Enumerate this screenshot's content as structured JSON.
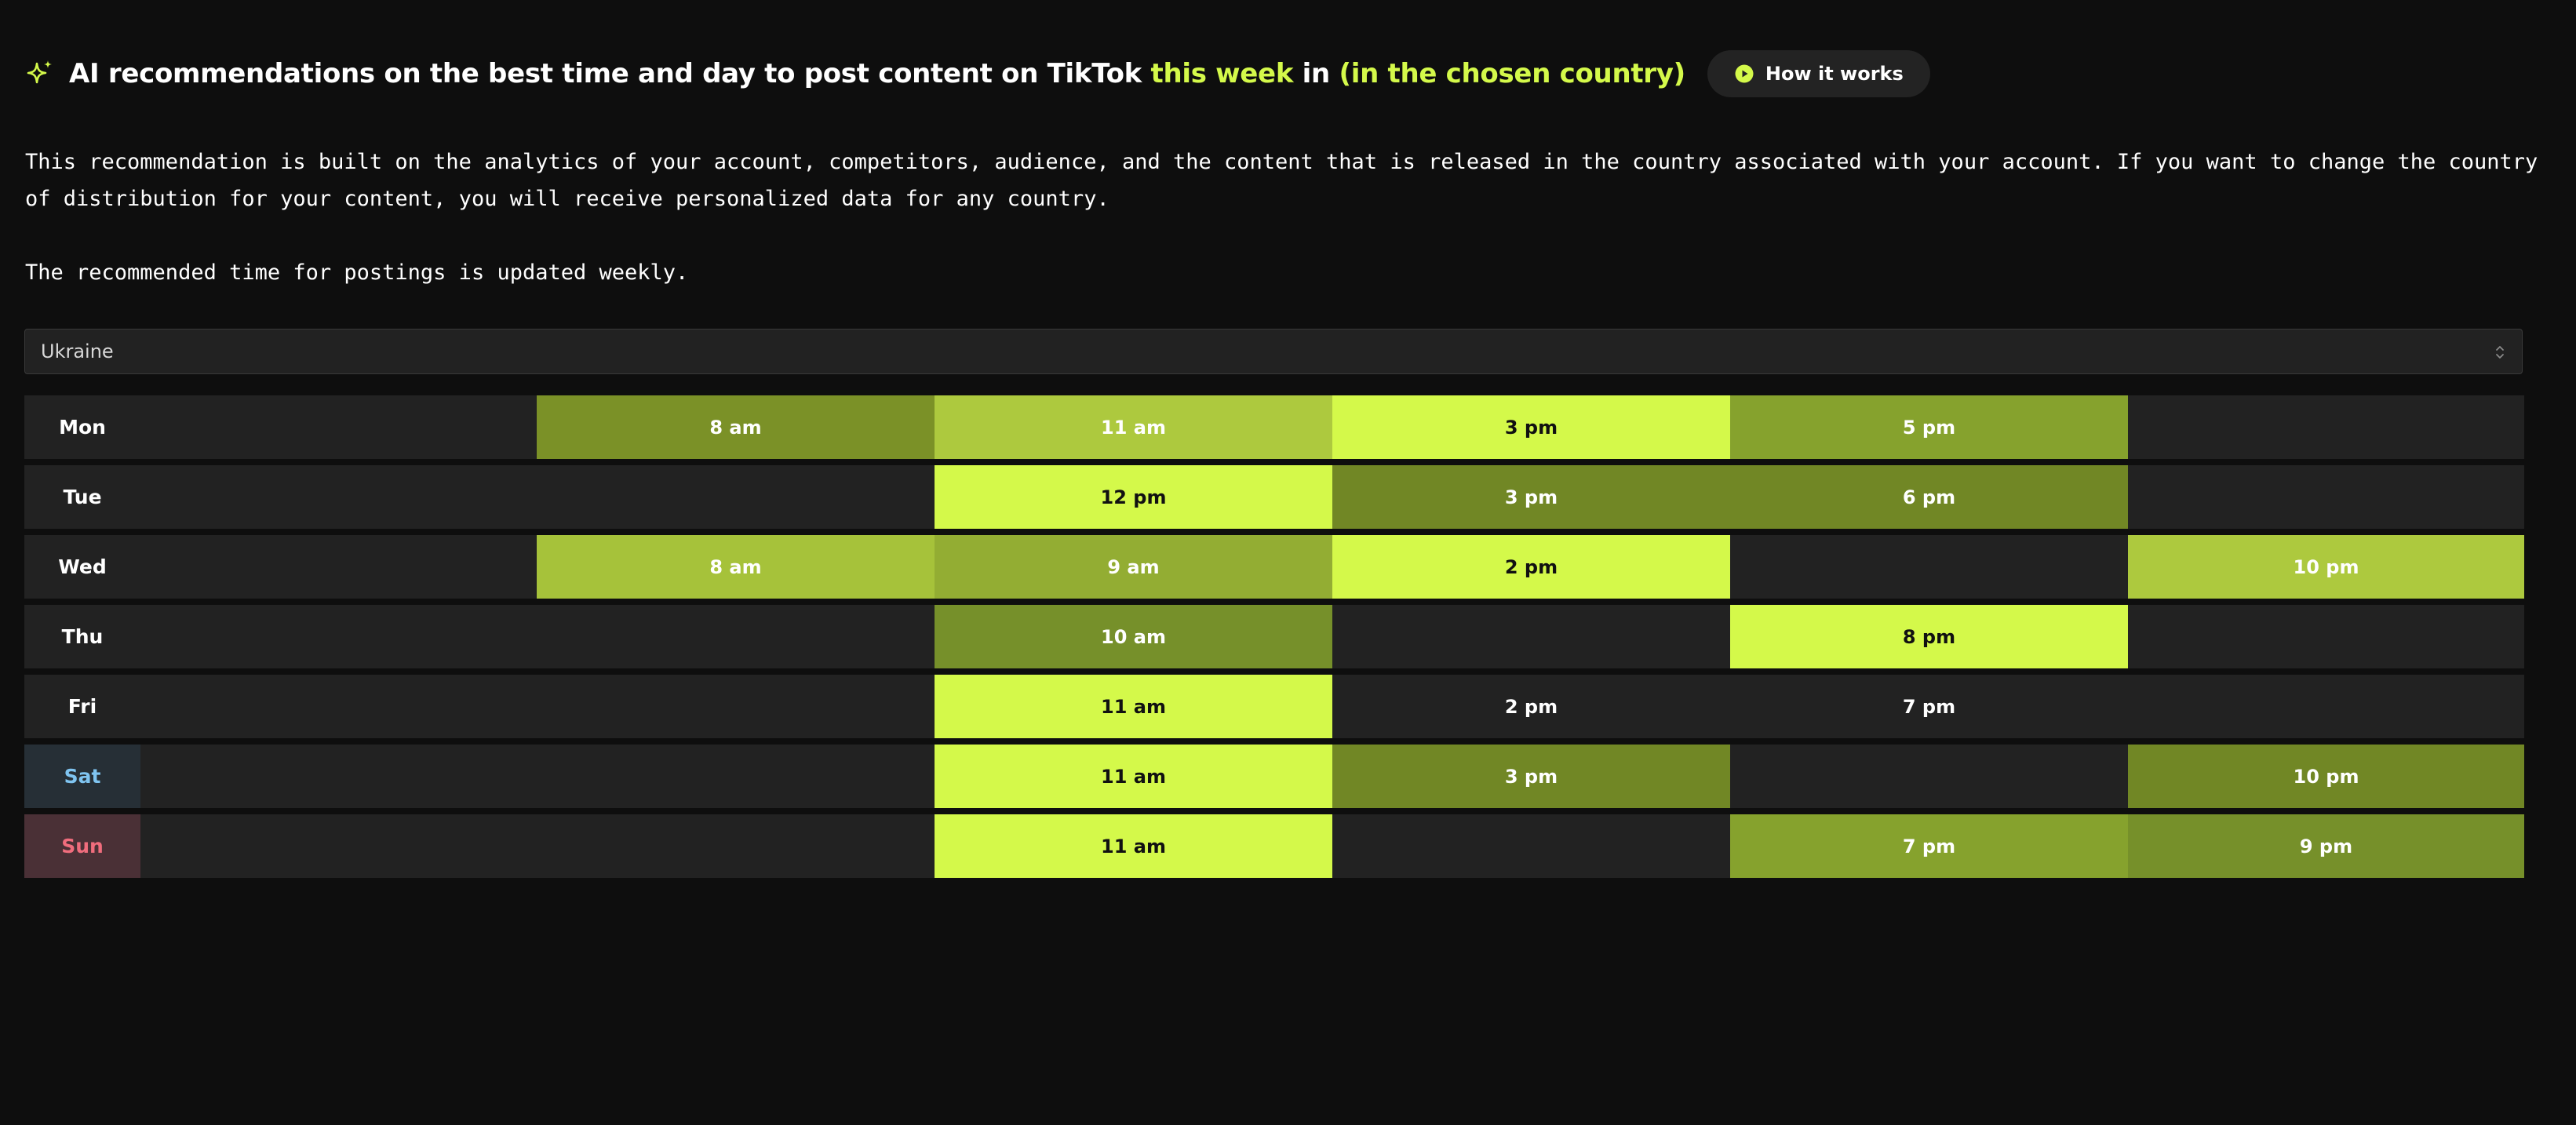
{
  "header": {
    "title_part1": "AI recommendations on the best time and day to post content on TikTok ",
    "title_highlight1": "this week",
    "title_part2": " in ",
    "title_highlight2": "(in the chosen country)",
    "how_it_works_label": "How it works",
    "icon": "sparkle-icon",
    "accent_color": "#d4f94a"
  },
  "description": {
    "paragraph1": "This recommendation is built on the analytics of your account, competitors, audience, and the content that is released in the country associated with your account. If you want to change the country of distribution for your content, you will receive personalized data for any country.",
    "paragraph2": "The recommended time for postings is updated weekly."
  },
  "country_select": {
    "value": "Ukraine"
  },
  "schedule": {
    "days": [
      {
        "label": "Mon",
        "slots": [
          null,
          {
            "time": "8 am",
            "color": "#7b9127"
          },
          {
            "time": "11 am",
            "color": "#adc93e"
          },
          {
            "time": "3 pm",
            "color": "#d4f94a"
          },
          {
            "time": "5 pm",
            "color": "#86a22d"
          },
          null
        ]
      },
      {
        "label": "Tue",
        "slots": [
          null,
          null,
          {
            "time": "12 pm",
            "color": "#d4f94a"
          },
          {
            "time": "3 pm",
            "color": "#718725"
          },
          {
            "time": "6 pm",
            "color": "#718725"
          },
          null
        ]
      },
      {
        "label": "Wed",
        "slots": [
          null,
          {
            "time": "8 am",
            "color": "#a6c23a"
          },
          {
            "time": "9 am",
            "color": "#93ad33"
          },
          {
            "time": "2 pm",
            "color": "#d4f94a"
          },
          null,
          {
            "time": "10 pm",
            "color": "#adc93e"
          }
        ]
      },
      {
        "label": "Thu",
        "slots": [
          null,
          null,
          {
            "time": "10 am",
            "color": "#76902a"
          },
          null,
          {
            "time": "8 pm",
            "color": "#d4f94a"
          },
          null
        ]
      },
      {
        "label": "Fri",
        "slots": [
          null,
          null,
          {
            "time": "11 am",
            "color": "#d4f94a"
          },
          {
            "time": "2 pm",
            "color": "#222222"
          },
          {
            "time": "7 pm",
            "color": "#222222"
          },
          null
        ]
      },
      {
        "label": "Sat",
        "slots": [
          null,
          null,
          {
            "time": "11 am",
            "color": "#d4f94a"
          },
          {
            "time": "3 pm",
            "color": "#718725"
          },
          null,
          {
            "time": "10 pm",
            "color": "#718725"
          }
        ]
      },
      {
        "label": "Sun",
        "slots": [
          null,
          null,
          {
            "time": "11 am",
            "color": "#d4f94a"
          },
          null,
          {
            "time": "7 pm",
            "color": "#86a22d"
          },
          {
            "time": "9 pm",
            "color": "#76902a"
          }
        ]
      }
    ]
  }
}
